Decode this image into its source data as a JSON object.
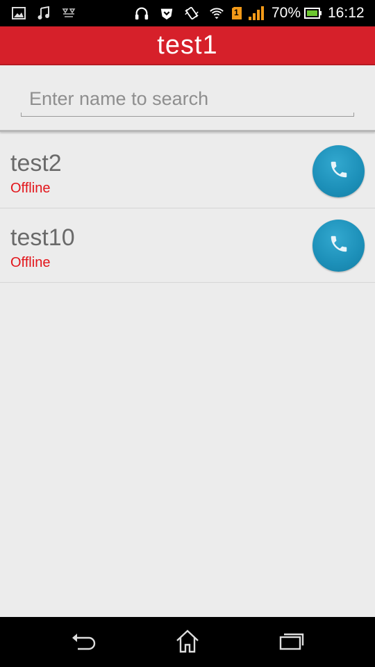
{
  "status_bar": {
    "battery_percent": "70%",
    "time": "16:12",
    "sim_slot": "1",
    "icons": [
      "image-icon",
      "music-note-icon",
      "signal-sync-icon",
      "headset-icon",
      "shield-hand-icon",
      "vibrate-icon",
      "wifi-icon",
      "sim-icon",
      "cell-signal-icon",
      "battery-icon"
    ]
  },
  "header": {
    "title": "test1"
  },
  "search": {
    "placeholder": "Enter name to search",
    "value": ""
  },
  "contacts": [
    {
      "name": "test2",
      "status": "Offline"
    },
    {
      "name": "test10",
      "status": "Offline"
    }
  ],
  "colors": {
    "header_bg": "#d6202a",
    "status_offline": "#e2151b",
    "call_button": "#1c8fb8",
    "background": "#ececec"
  },
  "nav_bar": {
    "buttons": [
      "back-icon",
      "home-icon",
      "recent-apps-icon"
    ]
  }
}
